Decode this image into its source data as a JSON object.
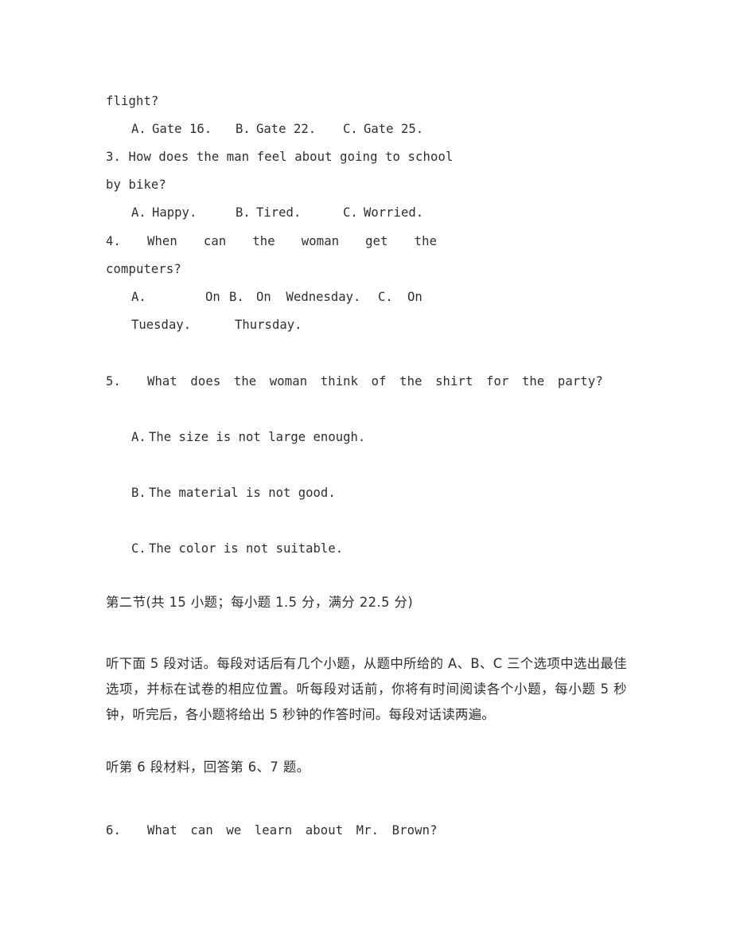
{
  "document": {
    "type": "exam-paper",
    "language": "en-zh",
    "background_color": "#ffffff",
    "text_color": "#2f2f2f"
  },
  "questions": [
    {
      "id": "q2-continued",
      "stem_continuation": "flight?",
      "options": [
        {
          "label": "A.",
          "text": "Gate 16."
        },
        {
          "label": "B.",
          "text": "Gate 22."
        },
        {
          "label": "C.",
          "text": "Gate 25."
        }
      ]
    },
    {
      "id": "q3",
      "number": "3.",
      "stem_line1": "3. How does the man feel about going to school",
      "stem_line2": "by bike?",
      "options": [
        {
          "label": "A.",
          "text": "Happy."
        },
        {
          "label": "B.",
          "text": "Tired."
        },
        {
          "label": "C.",
          "text": "Worried."
        }
      ]
    },
    {
      "id": "q4",
      "number": "4.",
      "stem_line1": "4.  When  can  the  woman  get  the",
      "stem_line2": "computers?",
      "options_wrapped": {
        "row1": {
          "a_label": "A.",
          "a_text_frag": "On",
          "b_label": "B.",
          "b_text": "On  Wednesday.",
          "c_label": "C.",
          "c_text_frag": "On"
        },
        "row2": {
          "a_text_frag": "Tuesday.",
          "c_text_frag": "Thursday."
        }
      }
    },
    {
      "id": "q5",
      "number": "5.",
      "stem": "5.  What does the woman think of the shirt for the party?",
      "options": [
        {
          "label": "A.",
          "text": "The size is not large enough."
        },
        {
          "label": "B.",
          "text": "The material is not good."
        },
        {
          "label": "C.",
          "text": "The color is not suitable."
        }
      ]
    },
    {
      "id": "q6",
      "number": "6.",
      "stem": "6.  What can we learn about Mr. Brown?"
    }
  ],
  "section": {
    "heading": "第二节(共 15 小题；每小题 1.5 分，满分 22.5 分)",
    "instructions": "听下面 5 段对话。每段对话后有几个小题，从题中所给的 A、B、C 三个选项中选出最佳选项，并标在试卷的相应位置。听每段对话前，你将有时间阅读各个小题，每小题 5 秒钟，听完后，各小题将给出 5 秒钟的作答时间。每段对话读两遍。",
    "material_cue": "听第 6 段材料，回答第 6、7 题。"
  }
}
